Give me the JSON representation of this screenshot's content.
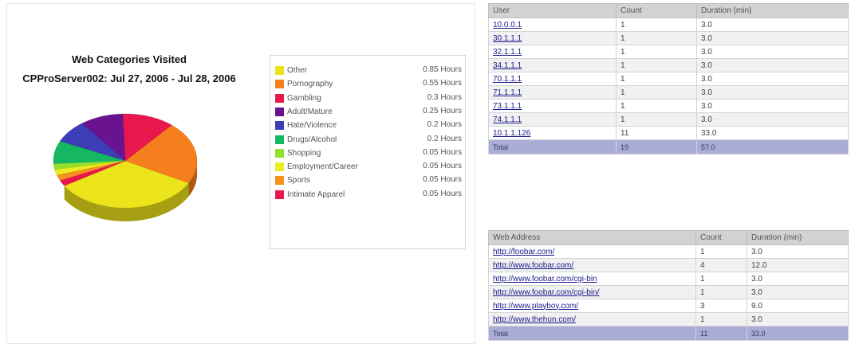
{
  "chart": {
    "title_line1": "Web Categories Visited",
    "title_line2": "CPProServer002: Jul 27, 2006 - Jul 28, 2006"
  },
  "chart_data": {
    "type": "pie",
    "title": "Web Categories Visited",
    "subtitle": "CPProServer002: Jul 27, 2006 - Jul 28, 2006",
    "legend_placement": "right",
    "categories": [
      "Other",
      "Pornography",
      "Gambling",
      "Adult/Mature",
      "Hate/Violence",
      "Drugs/Alcohol",
      "Shopping",
      "Employment/Career",
      "Sports",
      "Intimate Apparel"
    ],
    "values": [
      0.85,
      0.55,
      0.3,
      0.25,
      0.2,
      0.2,
      0.05,
      0.05,
      0.05,
      0.05
    ],
    "value_labels": [
      "0.85 Hours",
      "0.55 Hours",
      "0.3 Hours",
      "0.25 Hours",
      "0.2 Hours",
      "0.2 Hours",
      "0.05 Hours",
      "0.05 Hours",
      "0.05 Hours",
      "0.05 Hours"
    ],
    "colors": [
      "#ede31a",
      "#f57f1c",
      "#e8174c",
      "#6a1391",
      "#3d3db8",
      "#15b860",
      "#93e12a",
      "#ecec22",
      "#f5911d",
      "#e8154e"
    ]
  },
  "users_table": {
    "headers": [
      "User",
      "Count",
      "Duration (min)"
    ],
    "rows": [
      [
        "10.0.0.1",
        "1",
        "3.0"
      ],
      [
        "30.1.1.1",
        "1",
        "3.0"
      ],
      [
        "32.1.1.1",
        "1",
        "3.0"
      ],
      [
        "34.1.1.1",
        "1",
        "3.0"
      ],
      [
        "70.1.1.1",
        "1",
        "3.0"
      ],
      [
        "71.1.1.1",
        "1",
        "3.0"
      ],
      [
        "73.1.1.1",
        "1",
        "3.0"
      ],
      [
        "74.1.1.1",
        "1",
        "3.0"
      ],
      [
        "10.1.1.126",
        "11",
        "33.0"
      ]
    ],
    "total": [
      "Total",
      "19",
      "57.0"
    ]
  },
  "sites_table": {
    "headers": [
      "Web Address",
      "Count",
      "Duration (min)"
    ],
    "rows": [
      [
        "http://foobar.com/",
        "1",
        "3.0"
      ],
      [
        "http://www.foobar.com/",
        "4",
        "12.0"
      ],
      [
        "http://www.foobar.com/cgi-bin",
        "1",
        "3.0"
      ],
      [
        "http://www.foobar.com/cgi-bin/",
        "1",
        "3.0"
      ],
      [
        "http://www.playboy.com/",
        "3",
        "9.0"
      ],
      [
        "http://www.thehun.com/",
        "1",
        "3.0"
      ]
    ],
    "total": [
      "Total",
      "11",
      "33.0"
    ]
  }
}
